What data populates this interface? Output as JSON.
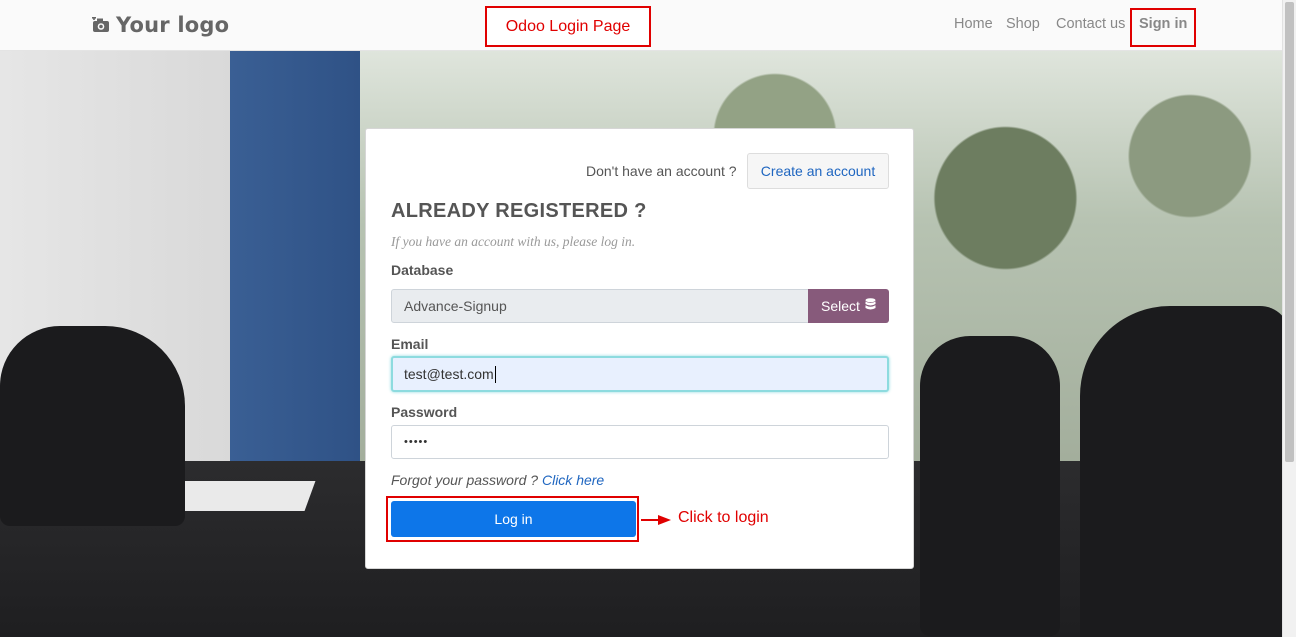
{
  "navbar": {
    "logo_text": "Your logo",
    "links": {
      "home": "Home",
      "shop": "Shop",
      "contact": "Contact us",
      "signin": "Sign in"
    }
  },
  "annotations": {
    "page_title": "Odoo Login Page",
    "login_hint": "Click to login",
    "color": "#e00000"
  },
  "login_card": {
    "no_account_text": "Don't have an account ?",
    "create_account_label": "Create an account",
    "heading": "ALREADY REGISTERED ?",
    "subtitle": "If you have an account with us, please log in.",
    "database": {
      "label": "Database",
      "value": "Advance-Signup",
      "select_label": "Select"
    },
    "email": {
      "label": "Email",
      "value": "test@test.com"
    },
    "password": {
      "label": "Password",
      "masked_value": "•••••"
    },
    "forgot_text": "Forgot your password ?",
    "forgot_link": "Click here",
    "login_label": "Log in"
  },
  "colors": {
    "primary_button": "#0d76e9",
    "odoo_purple": "#875a7b",
    "link": "#1f66c0"
  }
}
